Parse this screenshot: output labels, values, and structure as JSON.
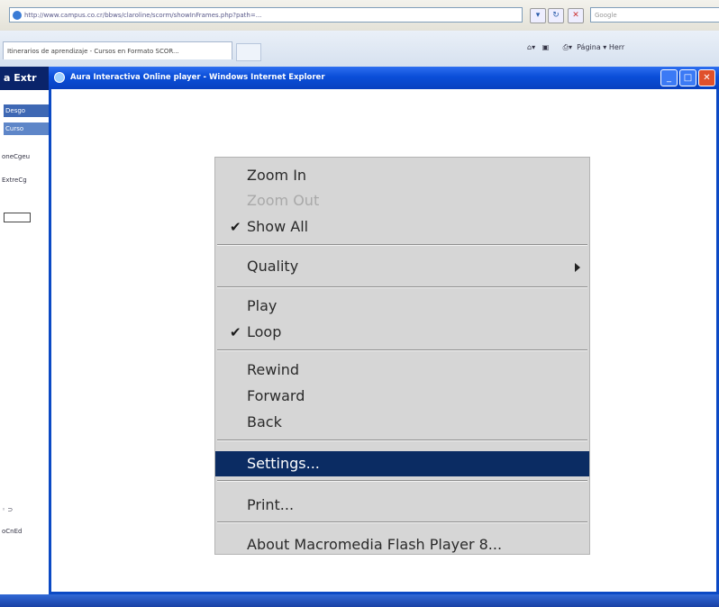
{
  "browser": {
    "address_url": "http://www.campus.co.cr/bbws/claroline/scorm/showInFrames.php?path=...",
    "search_placeholder": "Google",
    "tab_label": "Itinerarios de aprendizaje - Cursos en Formato SCOR...",
    "command_bar": "Página ▾  Herr"
  },
  "background_page": {
    "header_text": "a Extr",
    "nav_item_1": "Desgo",
    "nav_item_2": "Curso",
    "link_1": "oneCgeu",
    "link_2": "ExtreCg",
    "bottom_text": "oCnEd"
  },
  "popup": {
    "title": "Aura Interactiva Online player - Windows Internet Explorer"
  },
  "context_menu": {
    "items": [
      {
        "label": "Zoom In",
        "enabled": true,
        "checked": false
      },
      {
        "label": "Zoom Out",
        "enabled": false,
        "checked": false
      },
      {
        "label": "Show All",
        "enabled": true,
        "checked": true
      },
      {
        "label": "Quality",
        "enabled": true,
        "checked": false,
        "submenu": true
      },
      {
        "label": "Play",
        "enabled": true,
        "checked": false
      },
      {
        "label": "Loop",
        "enabled": true,
        "checked": true
      },
      {
        "label": "Rewind",
        "enabled": true,
        "checked": false
      },
      {
        "label": "Forward",
        "enabled": true,
        "checked": false
      },
      {
        "label": "Back",
        "enabled": true,
        "checked": false
      },
      {
        "label": "Settings...",
        "enabled": true,
        "checked": false,
        "selected": true
      },
      {
        "label": "Print...",
        "enabled": true,
        "checked": false
      },
      {
        "label": "About Macromedia Flash Player 8...",
        "enabled": true,
        "checked": false
      }
    ],
    "check_glyph": "✔",
    "selected_color": "#0b2c63"
  },
  "icons": [
    "ie-logo-icon",
    "go-arrow-icon",
    "minimize-icon",
    "maximize-icon",
    "close-icon",
    "check-icon",
    "submenu-arrow-icon"
  ]
}
